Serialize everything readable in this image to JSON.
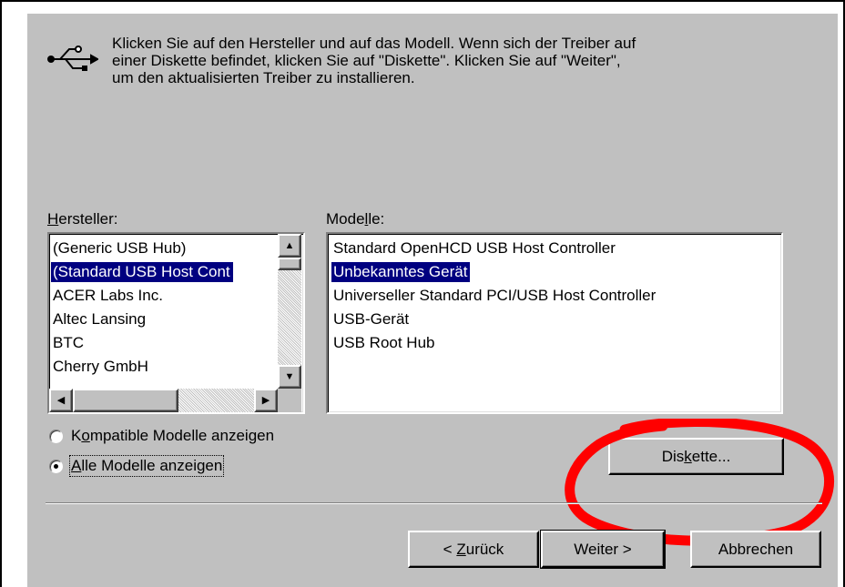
{
  "instructions": {
    "line1": "Klicken Sie auf den Hersteller und auf das Modell. Wenn sich der Treiber auf",
    "line2": "einer Diskette befindet, klicken Sie auf \"Diskette\". Klicken Sie auf \"Weiter\",",
    "line3": "um den aktualisierten Treiber zu installieren."
  },
  "manufacturer": {
    "label_mnemonic": "H",
    "label_rest": "ersteller:",
    "items": [
      "(Generic USB Hub)",
      "(Standard USB Host Cont",
      "ACER Labs Inc.",
      "Altec Lansing",
      "BTC",
      "Cherry GmbH"
    ],
    "selected_index": 1
  },
  "models": {
    "label_pre": "Mode",
    "label_mnemonic": "l",
    "label_post": "le:",
    "items": [
      "Standard OpenHCD USB Host Controller",
      "Unbekanntes Gerät",
      "Universeller Standard PCI/USB Host Controller",
      "USB-Gerät",
      "USB Root Hub"
    ],
    "selected_index": 1
  },
  "radios": {
    "compatible": {
      "pre": "K",
      "mnemonic": "o",
      "post": "mpatible Modelle anzeigen",
      "checked": false
    },
    "all": {
      "pre": "",
      "mnemonic": "A",
      "post": "lle Modelle anzeigen",
      "checked": true
    }
  },
  "buttons": {
    "diskette": {
      "pre": "Dis",
      "mnemonic": "k",
      "post": "ette..."
    },
    "back": {
      "pre": "< ",
      "mnemonic": "Z",
      "post": "urück"
    },
    "next": {
      "label": "Weiter >"
    },
    "cancel": {
      "label": "Abbrechen"
    }
  },
  "colors": {
    "dialog_bg": "#c0c0c0",
    "selection_bg": "#000080",
    "annotation": "#ff0000"
  },
  "icons": {
    "usb": "usb-icon",
    "scroll_up": "scroll-up-arrow-icon",
    "scroll_down": "scroll-down-arrow-icon",
    "scroll_left": "scroll-left-arrow-icon",
    "scroll_right": "scroll-right-arrow-icon"
  }
}
